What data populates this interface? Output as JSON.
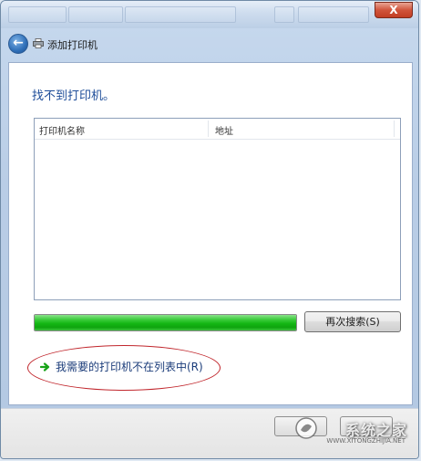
{
  "window": {
    "nav_title": "添加打印机",
    "close_label": "X"
  },
  "main": {
    "heading": "找不到打印机。",
    "list": {
      "columns": [
        "打印机名称",
        "地址"
      ],
      "rows": []
    },
    "progress": {
      "fraction": 1.0,
      "color": "#14b714"
    },
    "search_again_label": "再次搜索(S)",
    "not_listed_link": "我需要的打印机不在列表中(R)"
  },
  "footer": {
    "watermark": "系统之家",
    "watermark_url": "WWW.XITONGZHIJIA.NET"
  },
  "colors": {
    "heading": "#1e4d99",
    "annotation_oval": "#c1272d"
  },
  "icons": [
    "back-arrow-icon",
    "printer-icon",
    "green-arrow-icon",
    "close-icon"
  ]
}
